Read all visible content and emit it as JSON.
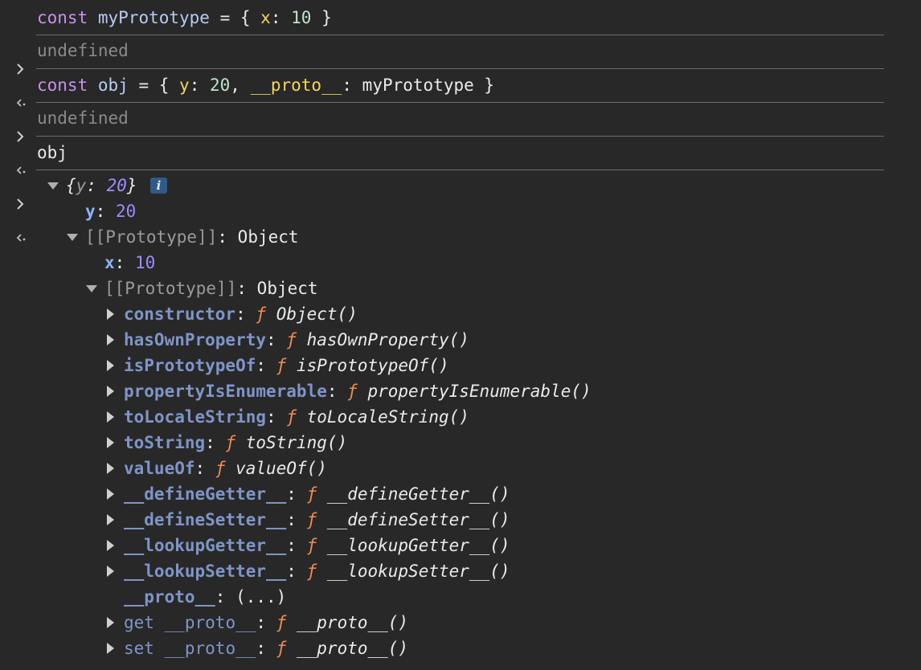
{
  "console": {
    "lines": [
      {
        "type": "input",
        "parts": {
          "kw": "const",
          "name": "myPrototype",
          "eq": " = { ",
          "key": "x",
          "colon": ": ",
          "val": "10",
          "end": " }"
        }
      },
      {
        "type": "output",
        "text": "undefined"
      },
      {
        "type": "input2",
        "parts": {
          "kw": "const",
          "name": "obj",
          "eq": " = { ",
          "key1": "y",
          "colon1": ": ",
          "val1": "20",
          "comma": ", ",
          "key2": "__proto__",
          "colon2": ": ",
          "ref": "myPrototype",
          "end": " }"
        }
      },
      {
        "type": "output",
        "text": "undefined"
      },
      {
        "type": "input3",
        "text": "obj"
      }
    ],
    "result": {
      "preview_open": "{",
      "preview_key": "y",
      "preview_sep": ": ",
      "preview_val": "20",
      "preview_close": "}",
      "info_badge": "i",
      "own_key": "y",
      "own_val": "20",
      "proto1_label": "[[Prototype]]",
      "proto1_type": "Object",
      "proto1_key": "x",
      "proto1_val": "10",
      "proto2_label": "[[Prototype]]",
      "proto2_type": "Object",
      "methods": [
        {
          "name": "constructor",
          "fn": "Object()"
        },
        {
          "name": "hasOwnProperty",
          "fn": "hasOwnProperty()"
        },
        {
          "name": "isPrototypeOf",
          "fn": "isPrototypeOf()"
        },
        {
          "name": "propertyIsEnumerable",
          "fn": "propertyIsEnumerable()"
        },
        {
          "name": "toLocaleString",
          "fn": "toLocaleString()"
        },
        {
          "name": "toString",
          "fn": "toString()"
        },
        {
          "name": "valueOf",
          "fn": "valueOf()"
        },
        {
          "name": "__defineGetter__",
          "fn": "__defineGetter__()"
        },
        {
          "name": "__defineSetter__",
          "fn": "__defineSetter__()"
        },
        {
          "name": "__lookupGetter__",
          "fn": "__lookupGetter__()"
        },
        {
          "name": "__lookupSetter__",
          "fn": "__lookupSetter__()"
        }
      ],
      "proto_accessor": {
        "name": "__proto__",
        "val": "(...)"
      },
      "getter": {
        "prefix": "get",
        "name": "__proto__",
        "fn": "__proto__()"
      },
      "setter": {
        "prefix": "set",
        "name": "__proto__",
        "fn": "__proto__()"
      },
      "f_symbol": "ƒ"
    }
  },
  "icons": {
    "input_prompt": "chevron-right-icon",
    "output_return": "return-arrow-icon",
    "expand_open": "triangle-down-icon",
    "expand_closed": "triangle-right-icon"
  },
  "colors": {
    "background": "#282828",
    "keyword": "#c792ea",
    "property_own": "#8ab4f8",
    "number": "#9e8cff",
    "function_f": "#f08c52",
    "proto_property": "#7f95c9"
  }
}
